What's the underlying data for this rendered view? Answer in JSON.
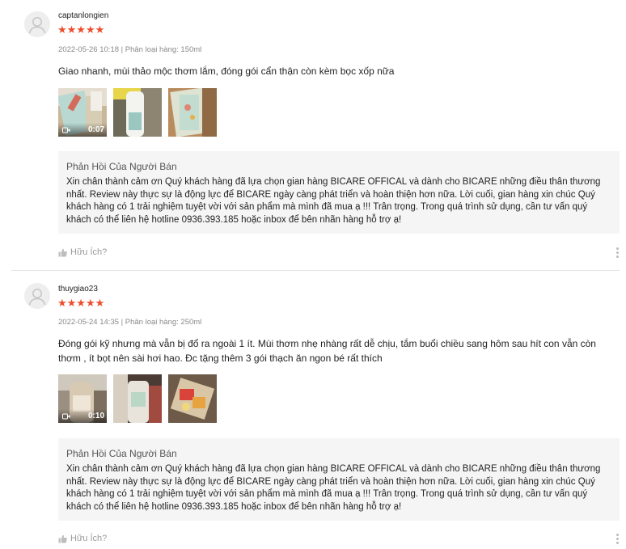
{
  "reviews": [
    {
      "username": "captanlongien",
      "stars": "★★★★★",
      "meta": "2022-05-26 10:18 | Phân loại hàng: 150ml",
      "comment": "Giao nhanh, mùi thảo mộc thơm lắm, đóng gói cẩn thận còn kèm bọc xốp nữa",
      "video_duration": "0:07",
      "reply_title": "Phản Hồi Của Người Bán",
      "reply_text": "Xin chân thành cảm ơn Quý khách hàng đã lựa chọn gian hàng BICARE OFFICAL và dành cho BICARE những điều thân thương nhất. Review này thực sự là động lực để BICARE ngày càng phát triển và hoàn thiện hơn nữa. Lời cuối, gian hàng xin chúc Quý khách hàng có 1 trải nghiệm tuyệt vời với sản phẩm mà mình đã mua ạ !!! Trân trọng. Trong quá trình sử dụng, cần tư vấn quý khách có thể liên hệ hotline 0936.393.185 hoặc inbox để bên nhãn hàng hỗ trợ ạ!",
      "helpful_label": "Hữu Ích?"
    },
    {
      "username": "thuygiao23",
      "stars": "★★★★★",
      "meta": "2022-05-24 14:35 | Phân loại hàng: 250ml",
      "comment": "Đóng gói kỹ nhưng mà vẫn bị đổ ra ngoài 1 ít. Mùi thơm nhẹ nhàng rất dễ chịu, tắm buổi chiều sang hôm sau hít con vẫn còn thơm , ít bọt nên sài hơi hao. Đc tặng thêm 3 gói thạch ăn ngon bé rất thích",
      "video_duration": "0:10",
      "reply_title": "Phản Hồi Của Người Bán",
      "reply_text": "Xin chân thành cảm ơn Quý khách hàng đã lựa chọn gian hàng BICARE OFFICAL và dành cho BICARE những điều thân thương nhất. Review này thực sự là động lực để BICARE ngày càng phát triển và hoàn thiện hơn nữa. Lời cuối, gian hàng xin chúc Quý khách hàng có 1 trải nghiệm tuyệt vời với sản phẩm mà mình đã mua ạ !!! Trân trọng. Trong quá trình sử dụng, cần tư vấn quý khách có thể liên hệ hotline 0936.393.185 hoặc inbox để bên nhãn hàng hỗ trợ ạ!",
      "helpful_label": "Hữu Ích?"
    }
  ],
  "colors": {
    "star": "#ee4d2d",
    "reply_bg": "#f5f5f5",
    "meta": "#8a8a8a"
  }
}
